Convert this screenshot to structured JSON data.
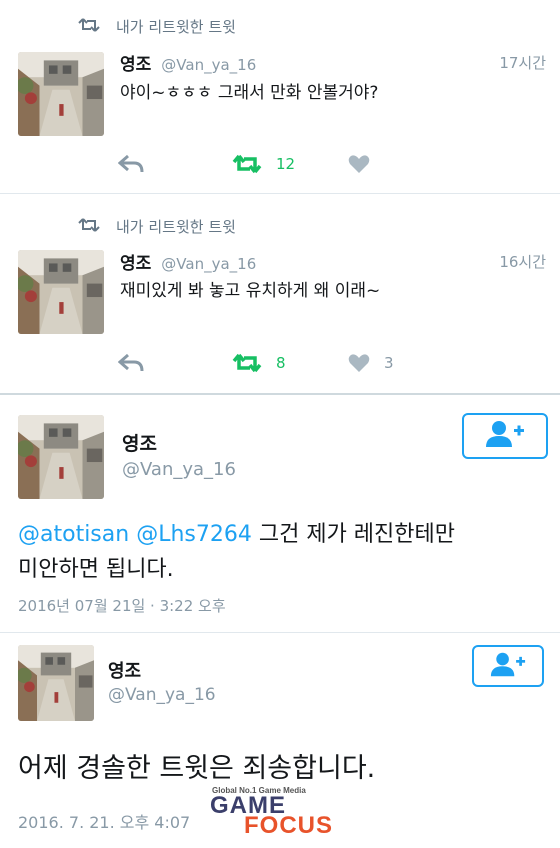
{
  "tweets": [
    {
      "retweet_label": "내가 리트윗한 트윗",
      "name": "영조",
      "handle": "@Van_ya_16",
      "time": "17시간",
      "text": "야이~ㅎㅎㅎ 그래서 만화 안볼거야?",
      "retweet_count": "12",
      "like_count": ""
    },
    {
      "retweet_label": "내가 리트윗한 트윗",
      "name": "영조",
      "handle": "@Van_ya_16",
      "time": "16시간",
      "text": "재미있게 봐 놓고 유치하게 왜 이래~",
      "retweet_count": "8",
      "like_count": "3"
    }
  ],
  "detail1": {
    "name": "영조",
    "handle": "@Van_ya_16",
    "mention1": "@atotisan",
    "mention2": "@Lhs7264",
    "text_line1": " 그건 제가 레진한테만",
    "text_line2": "미안하면 됩니다.",
    "timestamp": "2016년 07월 21일 · 3:22 오후"
  },
  "detail2": {
    "name": "영조",
    "handle": "@Van_ya_16",
    "text": "어제 경솔한 트윗은 죄송합니다.",
    "timestamp": "2016. 7. 21. 오후 4:07"
  },
  "watermark": {
    "small": "Global No.1 Game Media",
    "game": "GAME",
    "focus": "FOCUS"
  },
  "colors": {
    "accent": "#1da1f2",
    "retweet_green": "#17bf63",
    "muted": "#8899a6"
  }
}
